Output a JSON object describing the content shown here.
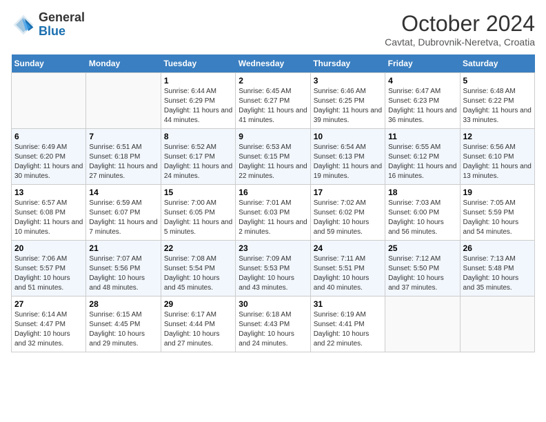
{
  "header": {
    "logo_line1": "General",
    "logo_line2": "Blue",
    "month": "October 2024",
    "location": "Cavtat, Dubrovnik-Neretva, Croatia"
  },
  "weekdays": [
    "Sunday",
    "Monday",
    "Tuesday",
    "Wednesday",
    "Thursday",
    "Friday",
    "Saturday"
  ],
  "weeks": [
    [
      {
        "day": "",
        "detail": ""
      },
      {
        "day": "",
        "detail": ""
      },
      {
        "day": "1",
        "detail": "Sunrise: 6:44 AM\nSunset: 6:29 PM\nDaylight: 11 hours and 44 minutes."
      },
      {
        "day": "2",
        "detail": "Sunrise: 6:45 AM\nSunset: 6:27 PM\nDaylight: 11 hours and 41 minutes."
      },
      {
        "day": "3",
        "detail": "Sunrise: 6:46 AM\nSunset: 6:25 PM\nDaylight: 11 hours and 39 minutes."
      },
      {
        "day": "4",
        "detail": "Sunrise: 6:47 AM\nSunset: 6:23 PM\nDaylight: 11 hours and 36 minutes."
      },
      {
        "day": "5",
        "detail": "Sunrise: 6:48 AM\nSunset: 6:22 PM\nDaylight: 11 hours and 33 minutes."
      }
    ],
    [
      {
        "day": "6",
        "detail": "Sunrise: 6:49 AM\nSunset: 6:20 PM\nDaylight: 11 hours and 30 minutes."
      },
      {
        "day": "7",
        "detail": "Sunrise: 6:51 AM\nSunset: 6:18 PM\nDaylight: 11 hours and 27 minutes."
      },
      {
        "day": "8",
        "detail": "Sunrise: 6:52 AM\nSunset: 6:17 PM\nDaylight: 11 hours and 24 minutes."
      },
      {
        "day": "9",
        "detail": "Sunrise: 6:53 AM\nSunset: 6:15 PM\nDaylight: 11 hours and 22 minutes."
      },
      {
        "day": "10",
        "detail": "Sunrise: 6:54 AM\nSunset: 6:13 PM\nDaylight: 11 hours and 19 minutes."
      },
      {
        "day": "11",
        "detail": "Sunrise: 6:55 AM\nSunset: 6:12 PM\nDaylight: 11 hours and 16 minutes."
      },
      {
        "day": "12",
        "detail": "Sunrise: 6:56 AM\nSunset: 6:10 PM\nDaylight: 11 hours and 13 minutes."
      }
    ],
    [
      {
        "day": "13",
        "detail": "Sunrise: 6:57 AM\nSunset: 6:08 PM\nDaylight: 11 hours and 10 minutes."
      },
      {
        "day": "14",
        "detail": "Sunrise: 6:59 AM\nSunset: 6:07 PM\nDaylight: 11 hours and 7 minutes."
      },
      {
        "day": "15",
        "detail": "Sunrise: 7:00 AM\nSunset: 6:05 PM\nDaylight: 11 hours and 5 minutes."
      },
      {
        "day": "16",
        "detail": "Sunrise: 7:01 AM\nSunset: 6:03 PM\nDaylight: 11 hours and 2 minutes."
      },
      {
        "day": "17",
        "detail": "Sunrise: 7:02 AM\nSunset: 6:02 PM\nDaylight: 10 hours and 59 minutes."
      },
      {
        "day": "18",
        "detail": "Sunrise: 7:03 AM\nSunset: 6:00 PM\nDaylight: 10 hours and 56 minutes."
      },
      {
        "day": "19",
        "detail": "Sunrise: 7:05 AM\nSunset: 5:59 PM\nDaylight: 10 hours and 54 minutes."
      }
    ],
    [
      {
        "day": "20",
        "detail": "Sunrise: 7:06 AM\nSunset: 5:57 PM\nDaylight: 10 hours and 51 minutes."
      },
      {
        "day": "21",
        "detail": "Sunrise: 7:07 AM\nSunset: 5:56 PM\nDaylight: 10 hours and 48 minutes."
      },
      {
        "day": "22",
        "detail": "Sunrise: 7:08 AM\nSunset: 5:54 PM\nDaylight: 10 hours and 45 minutes."
      },
      {
        "day": "23",
        "detail": "Sunrise: 7:09 AM\nSunset: 5:53 PM\nDaylight: 10 hours and 43 minutes."
      },
      {
        "day": "24",
        "detail": "Sunrise: 7:11 AM\nSunset: 5:51 PM\nDaylight: 10 hours and 40 minutes."
      },
      {
        "day": "25",
        "detail": "Sunrise: 7:12 AM\nSunset: 5:50 PM\nDaylight: 10 hours and 37 minutes."
      },
      {
        "day": "26",
        "detail": "Sunrise: 7:13 AM\nSunset: 5:48 PM\nDaylight: 10 hours and 35 minutes."
      }
    ],
    [
      {
        "day": "27",
        "detail": "Sunrise: 6:14 AM\nSunset: 4:47 PM\nDaylight: 10 hours and 32 minutes."
      },
      {
        "day": "28",
        "detail": "Sunrise: 6:15 AM\nSunset: 4:45 PM\nDaylight: 10 hours and 29 minutes."
      },
      {
        "day": "29",
        "detail": "Sunrise: 6:17 AM\nSunset: 4:44 PM\nDaylight: 10 hours and 27 minutes."
      },
      {
        "day": "30",
        "detail": "Sunrise: 6:18 AM\nSunset: 4:43 PM\nDaylight: 10 hours and 24 minutes."
      },
      {
        "day": "31",
        "detail": "Sunrise: 6:19 AM\nSunset: 4:41 PM\nDaylight: 10 hours and 22 minutes."
      },
      {
        "day": "",
        "detail": ""
      },
      {
        "day": "",
        "detail": ""
      }
    ]
  ]
}
